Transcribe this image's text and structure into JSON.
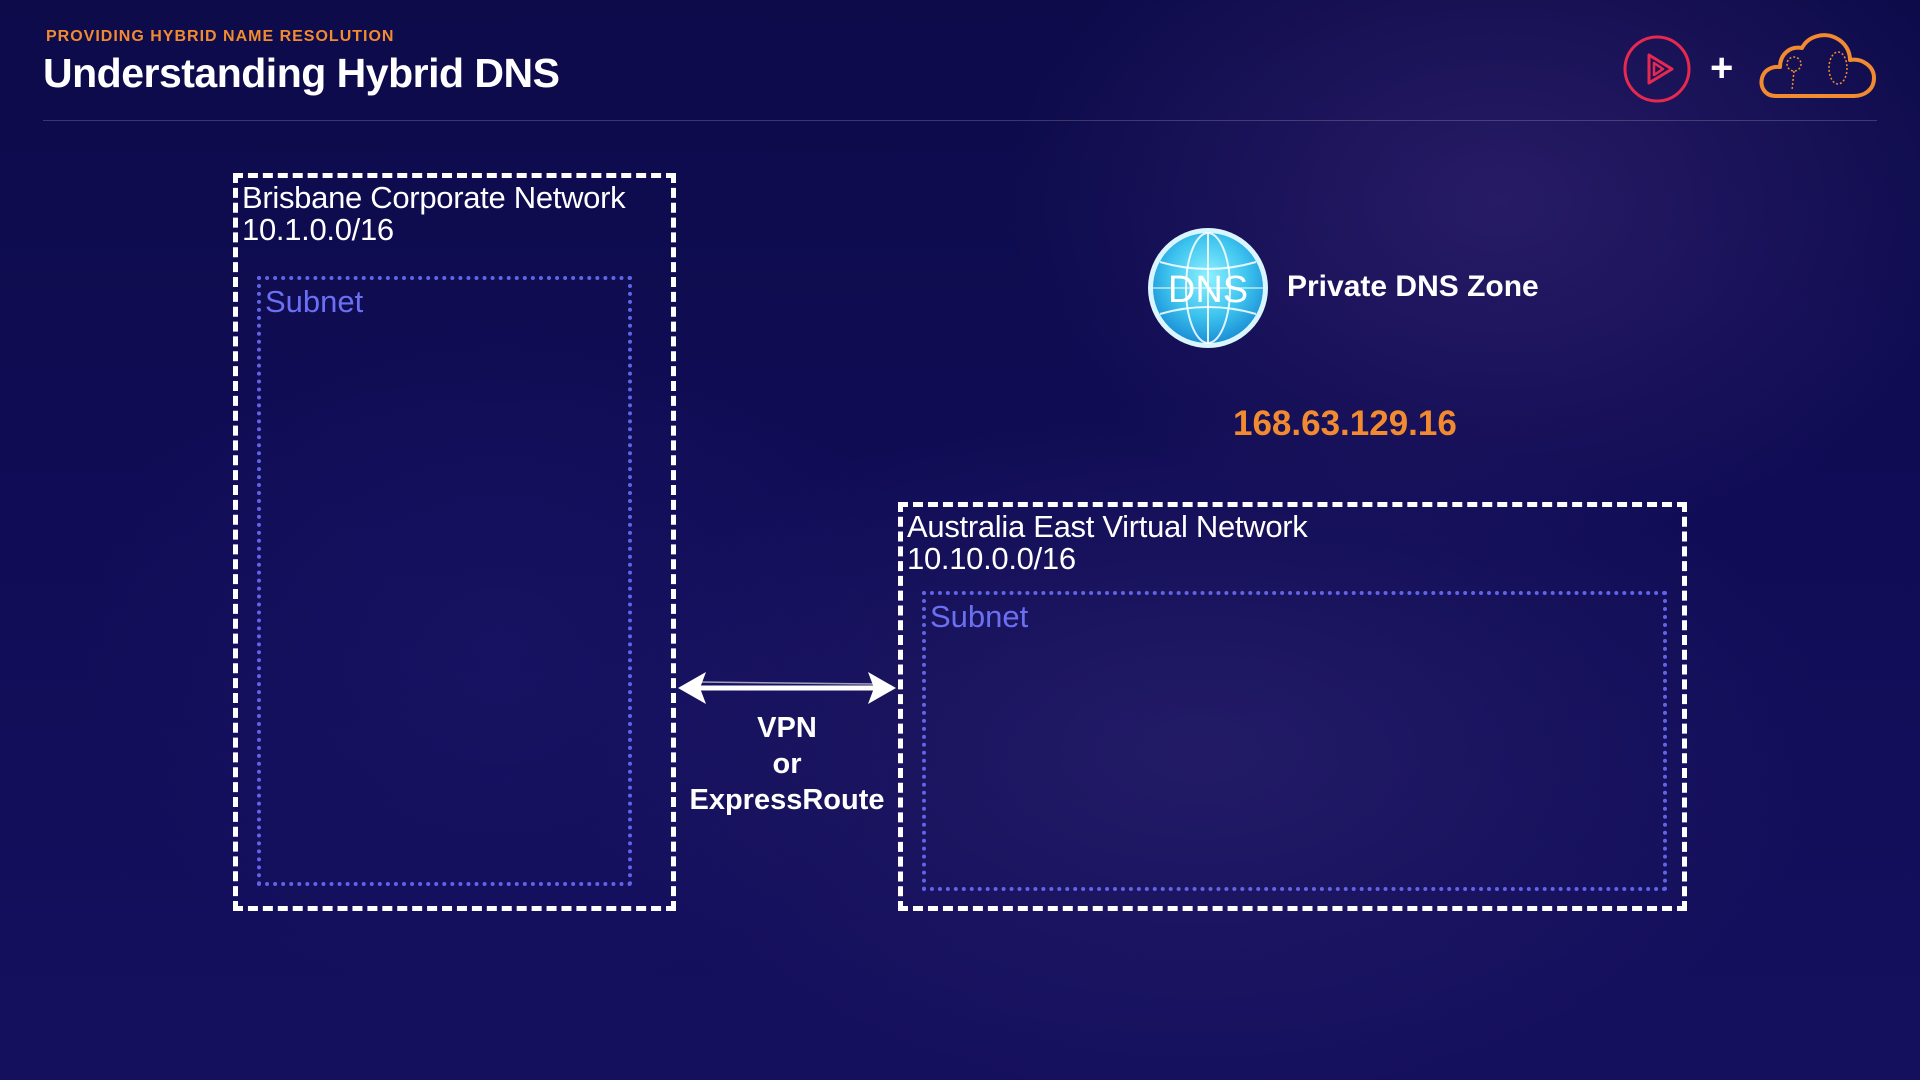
{
  "header": {
    "eyebrow": "PROVIDING HYBRID NAME RESOLUTION",
    "title": "Understanding Hybrid DNS"
  },
  "branding": {
    "play_logo_icon": "play-circle-icon",
    "plus": "+",
    "cloud_logo_icon": "cloud-icon",
    "accent_red": "#e8294f",
    "accent_orange": "#f28b30"
  },
  "networks": {
    "brisbane": {
      "name": "Brisbane Corporate Network",
      "cidr": "10.1.0.0/16",
      "subnet_label": "Subnet"
    },
    "australia_east": {
      "name": "Australia East Virtual Network",
      "cidr": "10.10.0.0/16",
      "subnet_label": "Subnet"
    }
  },
  "connection": {
    "line1": "VPN",
    "line2": "or",
    "line3": "ExpressRoute"
  },
  "dns": {
    "icon_text": "DNS",
    "zone_label": "Private DNS Zone",
    "ip": "168.63.129.16"
  },
  "colors": {
    "net_border": "#ffffff",
    "subnet_border": "#5f64e8",
    "ip_text": "#f28b30"
  }
}
